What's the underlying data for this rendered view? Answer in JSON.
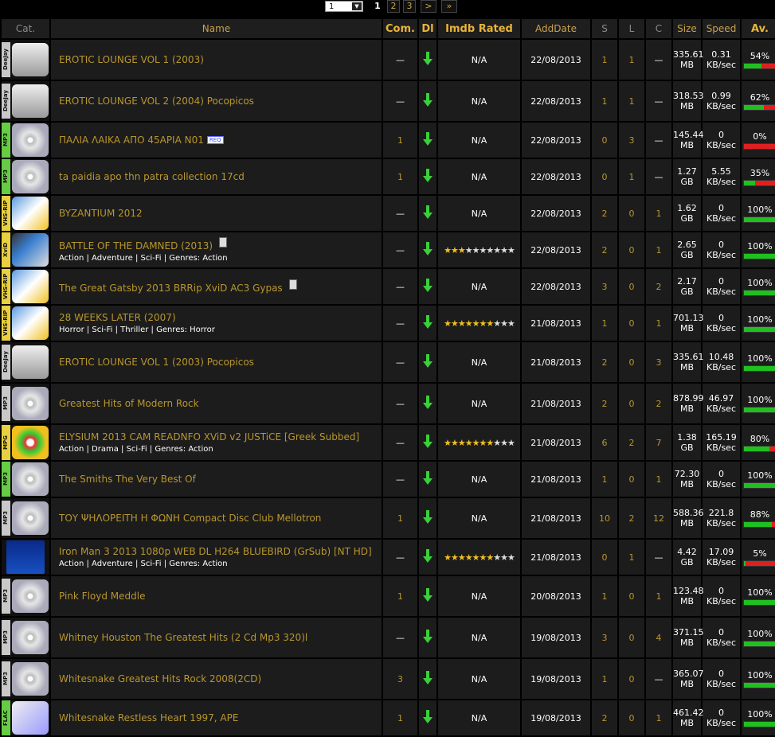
{
  "pager": {
    "select_value": "1",
    "pages": [
      "1",
      "2",
      "3"
    ],
    "next": ">",
    "last": "»"
  },
  "headers": {
    "cat": "Cat.",
    "name": "Name",
    "com": "Com.",
    "dl": "Dl",
    "imdb": "Imdb Rated",
    "adddate": "AddDate",
    "s": "S",
    "l": "L",
    "c": "C",
    "size": "Size",
    "speed": "Speed",
    "av": "Av."
  },
  "rows": [
    {
      "cat": "deejay",
      "catlabel": "DeeJay",
      "name": "EROTIC LOUNGE VOL 1 (2003)",
      "genres": "",
      "tag": "",
      "nfo": false,
      "com": "—",
      "imdb": "N/A",
      "date": "22/08/2013",
      "s": "1",
      "l": "1",
      "c": "—",
      "size": "335.61 MB",
      "speed": "0.31 KB/sec",
      "av": "54%",
      "avp": 54,
      "h": 50
    },
    {
      "cat": "deejay",
      "catlabel": "DeeJay",
      "name": "EROTIC LOUNGE VOL 2 (2004) Pocopicos",
      "genres": "",
      "tag": "",
      "nfo": false,
      "com": "—",
      "imdb": "N/A",
      "date": "22/08/2013",
      "s": "1",
      "l": "1",
      "c": "—",
      "size": "318.53 MB",
      "speed": "0.99 KB/sec",
      "av": "62%",
      "avp": 62,
      "h": 50
    },
    {
      "cat": "mp3",
      "catlabel": "MP3",
      "name": "ΠΑΛΙΑ ΛΑΙΚΑ ΑΠΟ 45ΑΡΙΑ Ν01",
      "genres": "",
      "tag": "REQ",
      "nfo": false,
      "com": "1",
      "imdb": "N/A",
      "date": "22/08/2013",
      "s": "0",
      "l": "3",
      "c": "—",
      "size": "145.44 MB",
      "speed": "0 KB/sec",
      "av": "0%",
      "avp": 0,
      "h": 38
    },
    {
      "cat": "mp3",
      "catlabel": "MP3",
      "name": "ta paidia apo thn patra collection 17cd",
      "genres": "",
      "tag": "",
      "nfo": false,
      "com": "1",
      "imdb": "N/A",
      "date": "22/08/2013",
      "s": "0",
      "l": "1",
      "c": "—",
      "size": "1.27 GB",
      "speed": "5.55 KB/sec",
      "av": "35%",
      "avp": 35,
      "h": 38
    },
    {
      "cat": "vhs",
      "catlabel": "VHS-RIP",
      "name": "BYZANTIUM 2012",
      "genres": "",
      "tag": "",
      "nfo": false,
      "com": "—",
      "imdb": "N/A",
      "date": "22/08/2013",
      "s": "2",
      "l": "0",
      "c": "1",
      "size": "1.62 GB",
      "speed": "0 KB/sec",
      "av": "100%",
      "avp": 100,
      "h": 38
    },
    {
      "cat": "xvid",
      "catlabel": "XviD",
      "name": "BATTLE OF THE DAMNED (2013)",
      "genres": "Action | Adventure | Sci-Fi |  Genres: Action",
      "tag": "",
      "nfo": true,
      "com": "—",
      "imdb": "stars3",
      "date": "22/08/2013",
      "s": "2",
      "l": "0",
      "c": "1",
      "size": "2.65 GB",
      "speed": "0 KB/sec",
      "av": "100%",
      "avp": 100,
      "h": 38
    },
    {
      "cat": "vhs",
      "catlabel": "VHS-RIP",
      "name": "The Great Gatsby 2013 BRRip XviD AC3 Gypas",
      "genres": "",
      "tag": "",
      "nfo": true,
      "com": "—",
      "imdb": "N/A",
      "date": "22/08/2013",
      "s": "3",
      "l": "0",
      "c": "2",
      "size": "2.17 GB",
      "speed": "0 KB/sec",
      "av": "100%",
      "avp": 100,
      "h": 38
    },
    {
      "cat": "vhs",
      "catlabel": "VHS-RIP",
      "name": "28 WEEKS LATER (2007)",
      "genres": "Horror | Sci-Fi | Thriller |  Genres: Horror",
      "tag": "",
      "nfo": false,
      "com": "—",
      "imdb": "stars7",
      "date": "21/08/2013",
      "s": "1",
      "l": "0",
      "c": "1",
      "size": "701.13 MB",
      "speed": "0 KB/sec",
      "av": "100%",
      "avp": 100,
      "h": 38
    },
    {
      "cat": "deejay",
      "catlabel": "DeeJay",
      "name": "EROTIC LOUNGE VOL 1 (2003) Pocopicos",
      "genres": "",
      "tag": "",
      "nfo": false,
      "com": "—",
      "imdb": "N/A",
      "date": "21/08/2013",
      "s": "2",
      "l": "0",
      "c": "3",
      "size": "335.61 MB",
      "speed": "10.48 KB/sec",
      "av": "100%",
      "avp": 100,
      "h": 50
    },
    {
      "cat": "mp3",
      "catlabel": "MP3",
      "name": "Greatest Hits of Modern Rock",
      "genres": "",
      "tag": "",
      "nfo": false,
      "com": "—",
      "imdb": "N/A",
      "date": "21/08/2013",
      "s": "2",
      "l": "0",
      "c": "2",
      "size": "878.99 MB",
      "speed": "46.97 KB/sec",
      "av": "100%",
      "avp": 100,
      "h": 50
    },
    {
      "cat": "mpg",
      "catlabel": "MPG",
      "name": "ELYSIUM 2013 CAM READNFO XViD v2 JUSTiCE [Greek Subbed]",
      "genres": "Action | Drama | Sci-Fi |  Genres: Action",
      "tag": "",
      "nfo": false,
      "com": "—",
      "imdb": "stars7",
      "date": "21/08/2013",
      "s": "6",
      "l": "2",
      "c": "7",
      "size": "1.38 GB",
      "speed": "165.19 KB/sec",
      "av": "80%",
      "avp": 80,
      "h": 38
    },
    {
      "cat": "mp3",
      "catlabel": "MP3",
      "name": "The Smiths The Very Best Of",
      "genres": "",
      "tag": "",
      "nfo": false,
      "com": "—",
      "imdb": "N/A",
      "date": "21/08/2013",
      "s": "1",
      "l": "0",
      "c": "1",
      "size": "72.30 MB",
      "speed": "0 KB/sec",
      "av": "100%",
      "avp": 100,
      "h": 38
    },
    {
      "cat": "mp3",
      "catlabel": "MP3",
      "name": "ΤΟΥ ΨΗΛΟΡΕΙΤΗ Η ΦΩΝΗ Compact Disc Club Mellotron",
      "genres": "",
      "tag": "",
      "nfo": false,
      "com": "1",
      "imdb": "N/A",
      "date": "21/08/2013",
      "s": "10",
      "l": "2",
      "c": "12",
      "size": "588.36 MB",
      "speed": "221.8 KB/sec",
      "av": "88%",
      "avp": 88,
      "h": 50
    },
    {
      "cat": "blu",
      "catlabel": "",
      "name": "Iron Man 3 2013 1080p WEB DL H264 BLUEBIRD (GrSub) [NT HD]",
      "genres": "Action | Adventure | Sci-Fi |  Genres: Action",
      "tag": "",
      "nfo": false,
      "com": "—",
      "imdb": "stars7",
      "date": "21/08/2013",
      "s": "0",
      "l": "1",
      "c": "—",
      "size": "4.42 GB",
      "speed": "17.09 KB/sec",
      "av": "5%",
      "avp": 5,
      "h": 38
    },
    {
      "cat": "mp3",
      "catlabel": "MP3",
      "name": "Pink Floyd Meddle",
      "genres": "",
      "tag": "",
      "nfo": false,
      "com": "1",
      "imdb": "N/A",
      "date": "20/08/2013",
      "s": "1",
      "l": "0",
      "c": "1",
      "size": "123.48 MB",
      "speed": "0 KB/sec",
      "av": "100%",
      "avp": 100,
      "h": 50
    },
    {
      "cat": "mp3",
      "catlabel": "MP3",
      "name": "Whitney Houston The Greatest Hits (2 Cd Mp3 320)l",
      "genres": "",
      "tag": "",
      "nfo": false,
      "com": "—",
      "imdb": "N/A",
      "date": "19/08/2013",
      "s": "3",
      "l": "0",
      "c": "4",
      "size": "371.15 MB",
      "speed": "0 KB/sec",
      "av": "100%",
      "avp": 100,
      "h": 50
    },
    {
      "cat": "mp3",
      "catlabel": "MP3",
      "name": "Whitesnake Greatest Hits Rock 2008(2CD)",
      "genres": "",
      "tag": "",
      "nfo": false,
      "com": "3",
      "imdb": "N/A",
      "date": "19/08/2013",
      "s": "1",
      "l": "0",
      "c": "—",
      "size": "365.07 MB",
      "speed": "0 KB/sec",
      "av": "100%",
      "avp": 100,
      "h": 50
    },
    {
      "cat": "flac",
      "catlabel": "FLAC",
      "name": "Whitesnake Restless Heart 1997, APE",
      "genres": "",
      "tag": "",
      "nfo": false,
      "com": "1",
      "imdb": "N/A",
      "date": "19/08/2013",
      "s": "2",
      "l": "0",
      "c": "1",
      "size": "461.42 MB",
      "speed": "0 KB/sec",
      "av": "100%",
      "avp": 100,
      "h": 38
    }
  ]
}
